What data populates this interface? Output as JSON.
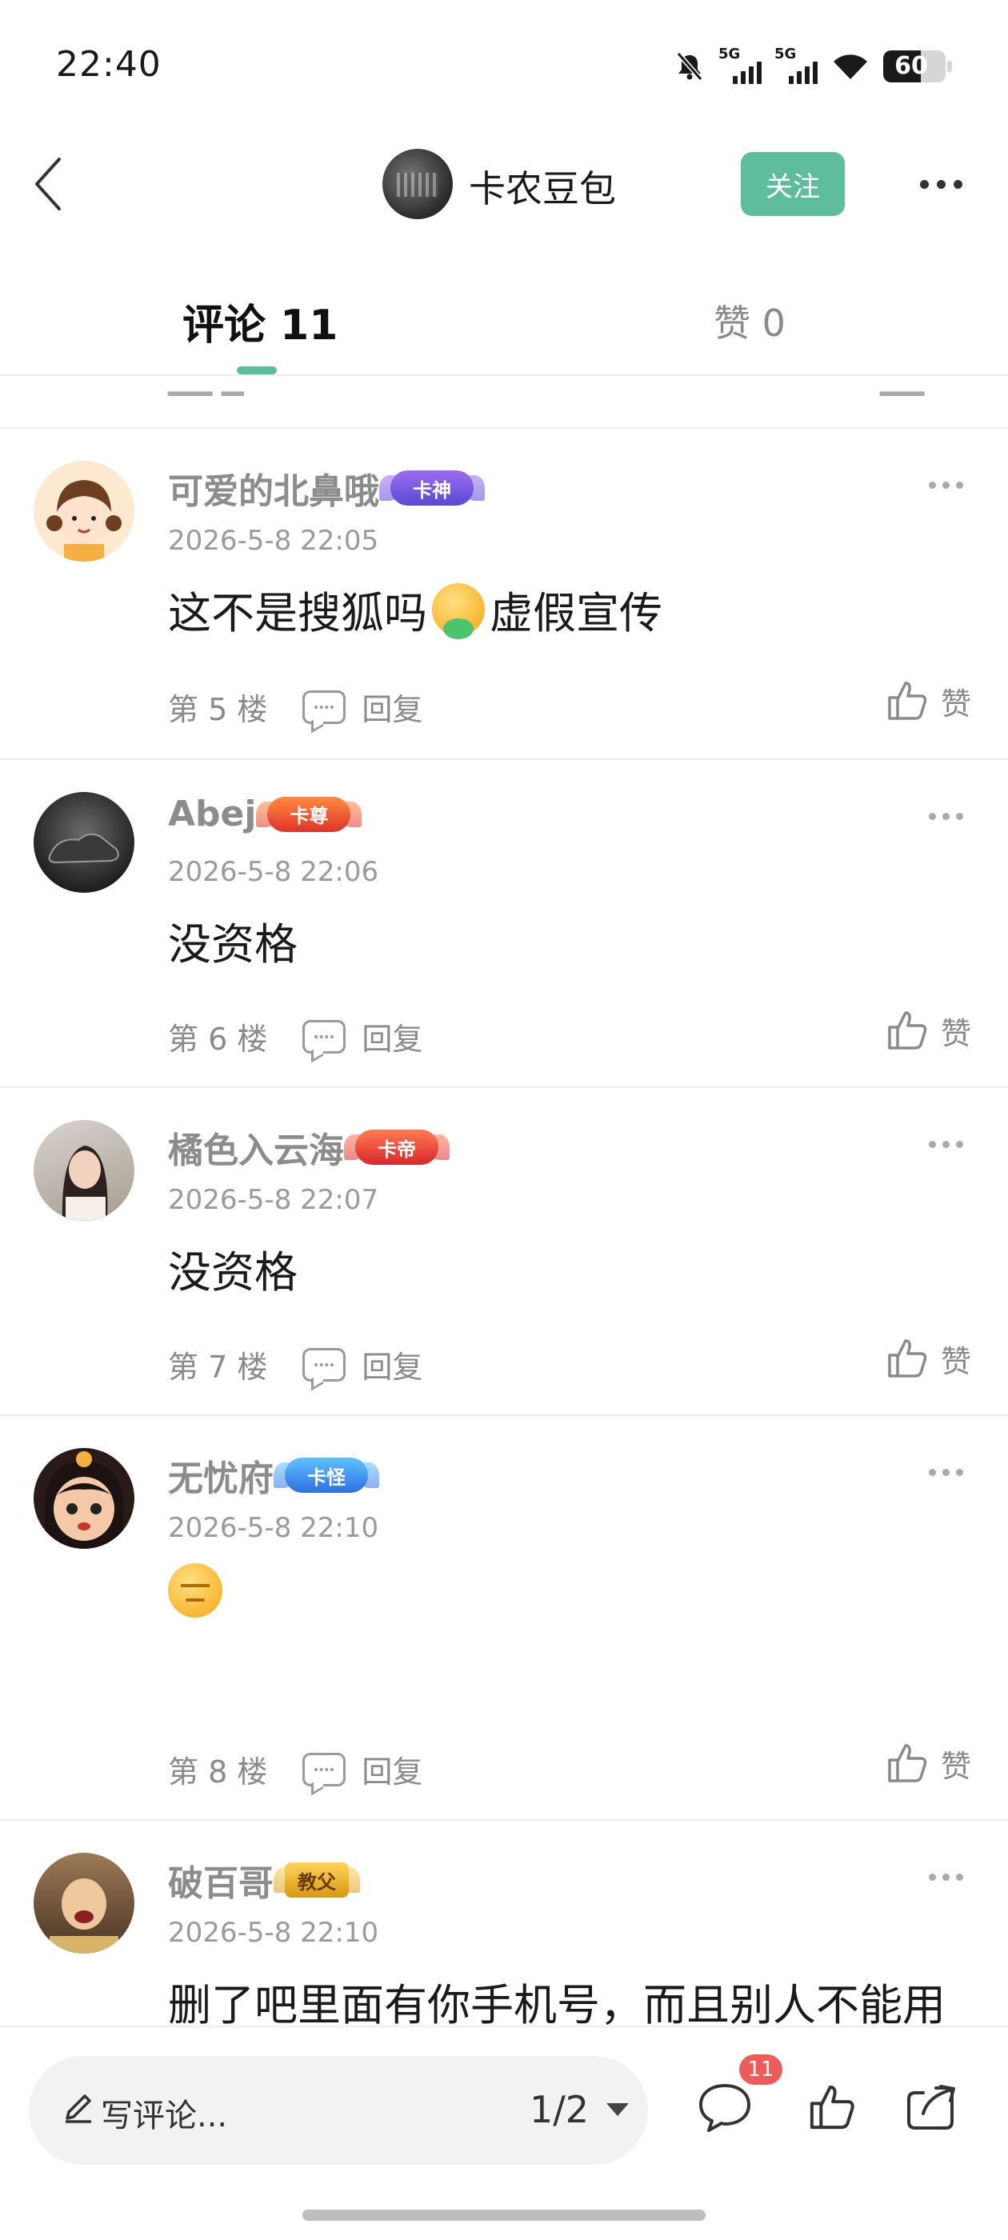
{
  "status_bar": {
    "time": "22:40",
    "network_1": "5G",
    "network_2": "5G",
    "battery": "60"
  },
  "header": {
    "author_name": "卡农豆包",
    "follow_label": "关注"
  },
  "tabs": {
    "comments_label": "评论 11",
    "likes_label": "赞 0"
  },
  "comments": [
    {
      "username": "可爱的北鼻哦",
      "badge": "卡神",
      "time": "2026-5-8 22:05",
      "text_before": "这不是搜狐吗",
      "emoji": "vomit-face-emoji",
      "text_after": "虚假宣传",
      "floor": "第 5 楼",
      "reply_label": "回复",
      "like_label": "赞"
    },
    {
      "username": "Abej",
      "badge": "卡尊",
      "time": "2026-5-8 22:06",
      "text": "没资格",
      "floor": "第 6 楼",
      "reply_label": "回复",
      "like_label": "赞"
    },
    {
      "username": "橘色入云海",
      "badge": "卡帝",
      "time": "2026-5-8 22:07",
      "text": "没资格",
      "floor": "第 7 楼",
      "reply_label": "回复",
      "like_label": "赞"
    },
    {
      "username": "无忧府",
      "badge": "卡怪",
      "time": "2026-5-8 22:10",
      "emoji": "grumpy-face-emoji",
      "floor": "第 8 楼",
      "reply_label": "回复",
      "like_label": "赞"
    },
    {
      "username": "破百哥",
      "badge": "教父",
      "time": "2026-5-8 22:10",
      "text": "删了吧里面有你手机号，而且别人不能用"
    }
  ],
  "bottom_bar": {
    "input_placeholder": "写评论...",
    "page_indicator": "1/2",
    "comment_count": "11"
  },
  "colors": {
    "accent": "#5dbd9c",
    "badge_red": "#ee5b5b",
    "muted_text": "#8c8c8c"
  }
}
